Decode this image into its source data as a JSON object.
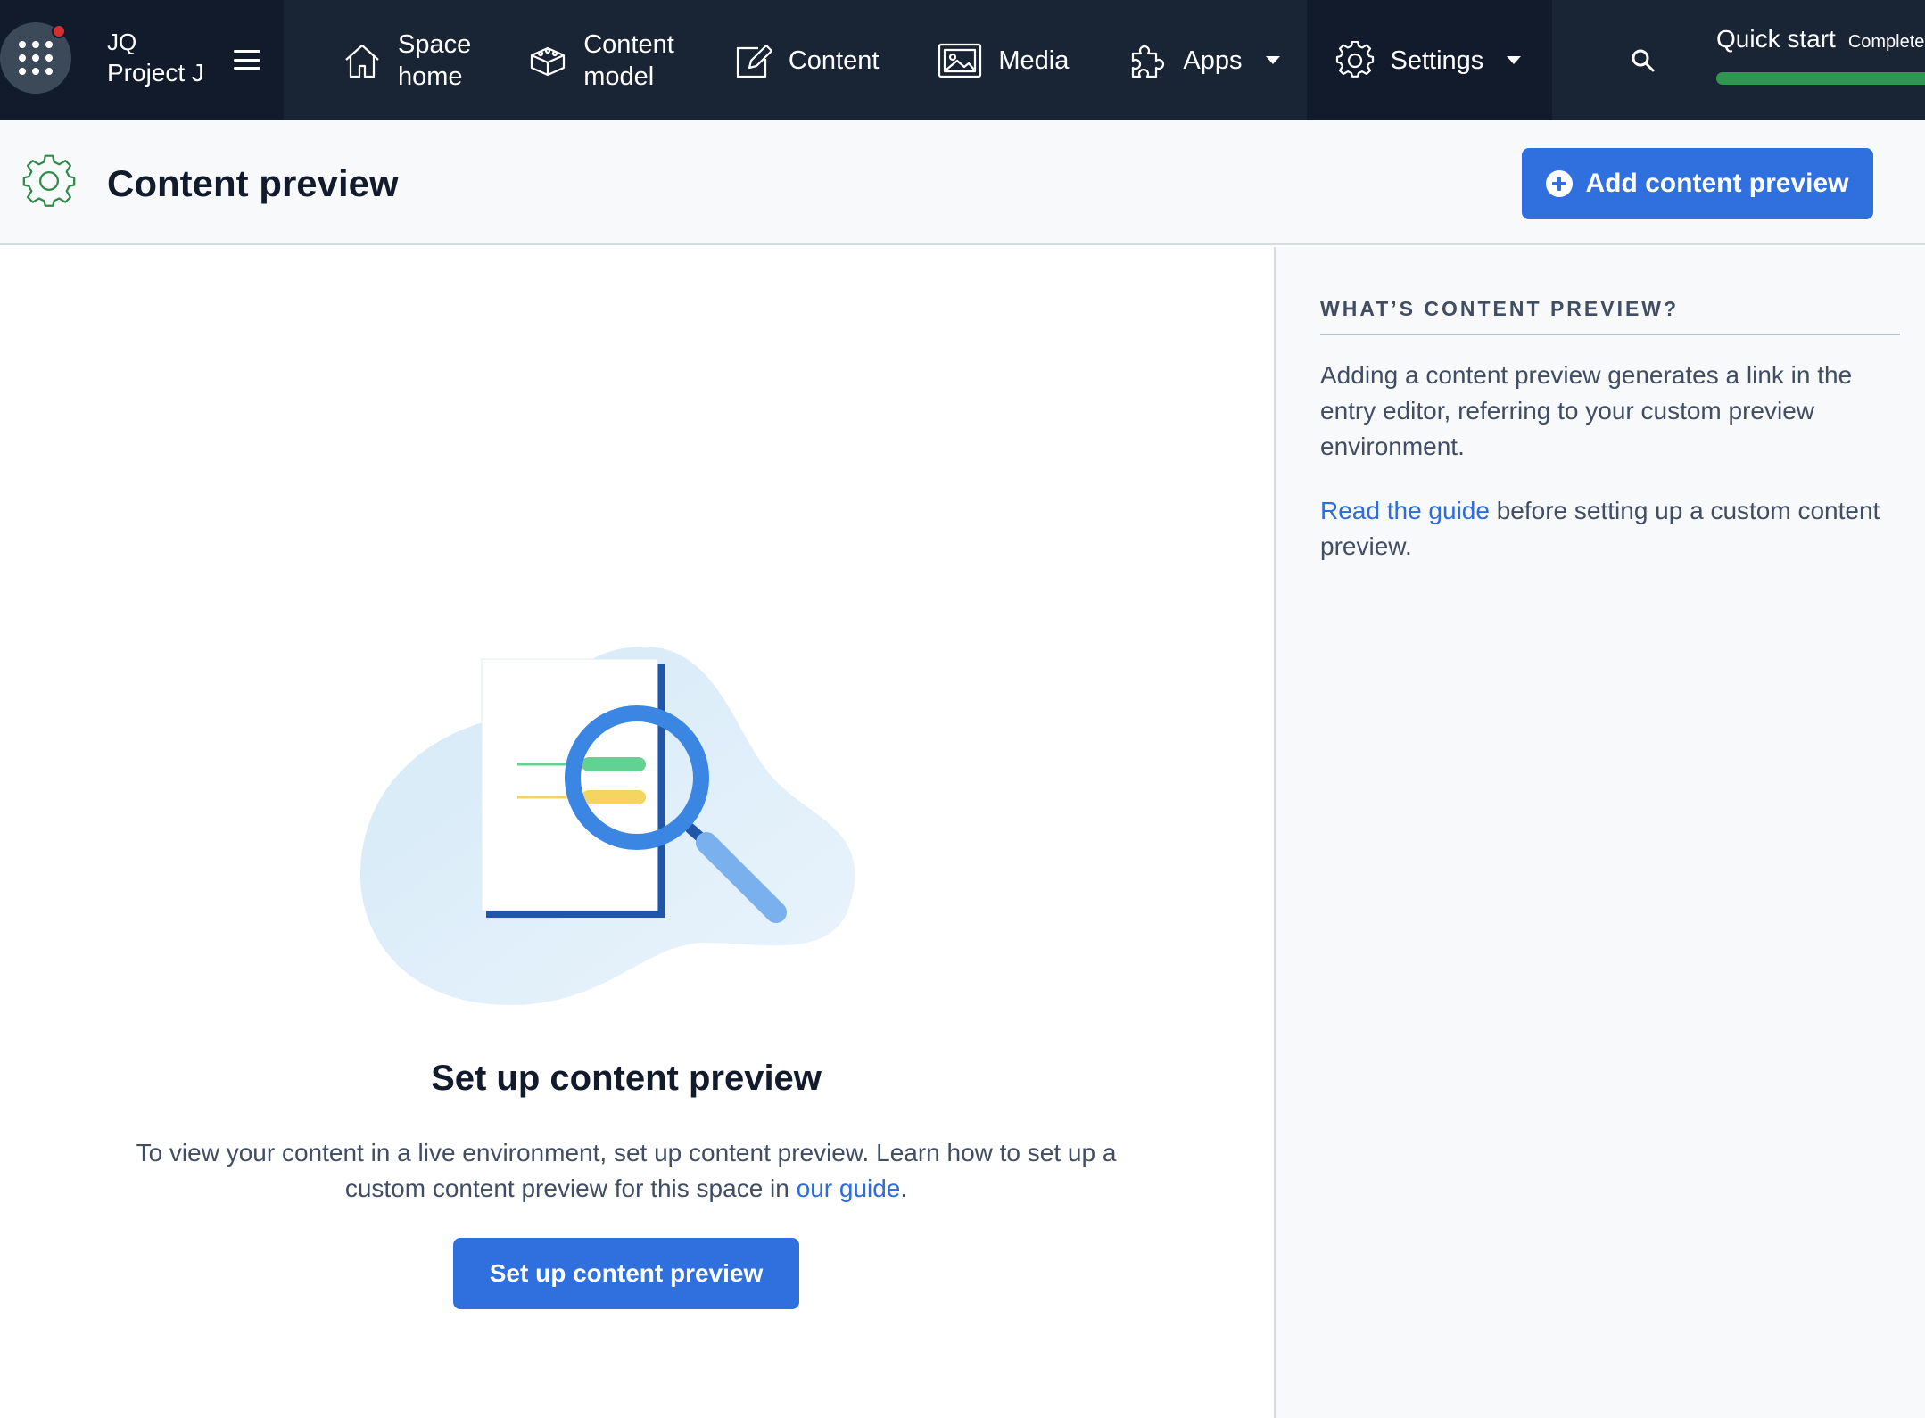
{
  "org": {
    "initials": "JQ",
    "name": "Project J"
  },
  "nav": {
    "items": [
      {
        "label": "Space\nhome",
        "icon": "home-icon"
      },
      {
        "label": "Content\nmodel",
        "icon": "content-model-icon"
      },
      {
        "label": "Content",
        "icon": "content-edit-icon"
      },
      {
        "label": "Media",
        "icon": "media-icon"
      },
      {
        "label": "Apps",
        "icon": "apps-puzzle-icon"
      },
      {
        "label": "Settings",
        "icon": "gear-icon"
      }
    ],
    "search_icon": "search-icon",
    "quick_start": {
      "title": "Quick start",
      "status": "Complete",
      "progress": 1.0
    }
  },
  "header": {
    "title": "Content preview",
    "add_button": "Add content preview"
  },
  "empty_state": {
    "title": "Set up content preview",
    "desc_before": "To view your content in a live environment, set up content preview. Learn how to set up a custom content preview for this space in ",
    "desc_link": "our guide",
    "desc_after": ".",
    "button": "Set up content preview"
  },
  "sidebar": {
    "heading": "WHAT’S CONTENT PREVIEW?",
    "p1": "Adding a content preview generates a link in the entry editor, referring to your custom preview environment.",
    "p2_link": "Read the guide",
    "p2_rest": " before setting up a custom content preview."
  },
  "colors": {
    "nav_bg": "#192434",
    "nav_dark": "#111b2b",
    "primary": "#2f6fde",
    "link": "#2d6cd9",
    "progress": "#2f9652",
    "notification": "#d72f2f"
  }
}
